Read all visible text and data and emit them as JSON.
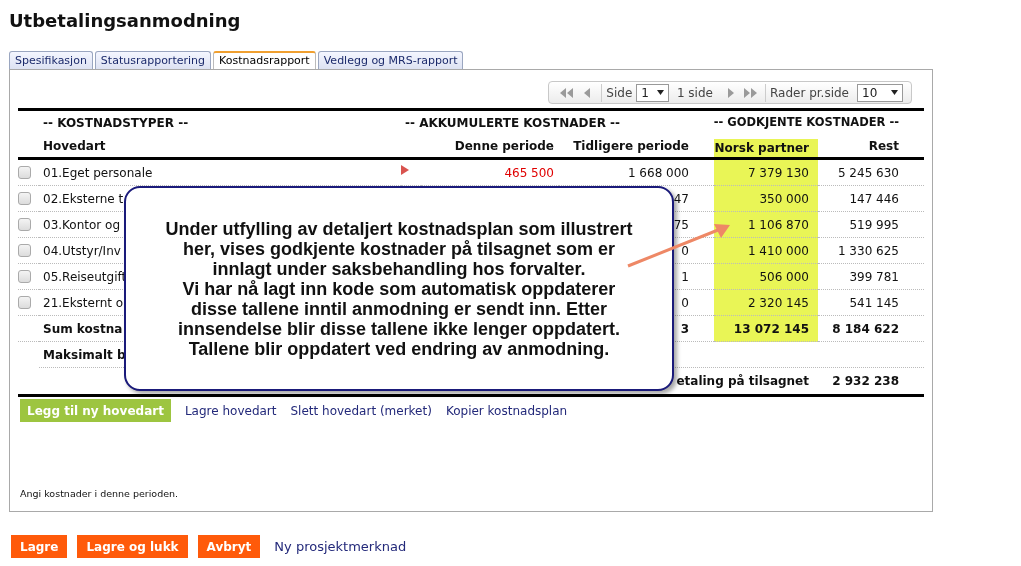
{
  "page_title": "Utbetalingsanmodning",
  "tabs": [
    {
      "label": "Spesifikasjon",
      "selected": false
    },
    {
      "label": "Statusrapportering",
      "selected": false
    },
    {
      "label": "Kostnadsrapport",
      "selected": true
    },
    {
      "label": "Vedlegg og MRS-rapport",
      "selected": false
    }
  ],
  "pager": {
    "page_label": "Side",
    "page": "1",
    "page_count": "1 side",
    "rows_label": "Rader pr.side",
    "rows_per_page": "10"
  },
  "table": {
    "groups": [
      "-- KOSTNADSTYPER --",
      "-- AKKUMULERTE KOSTNADER --",
      "-- GODKJENTE KOSTNADER --"
    ],
    "columns": [
      "Hovedart",
      "Denne periode",
      "Tidligere periode",
      "Norsk partner",
      "Rest"
    ],
    "rows": [
      {
        "kind": "item",
        "checked": false,
        "marker": true,
        "hovedart": "01.Eget personale",
        "denne_periode": "465 500",
        "tidligere_periode": "1 668 000",
        "norsk_partner": "7 379 130",
        "rest": "5 245 630"
      },
      {
        "kind": "item",
        "checked": false,
        "marker": false,
        "hovedart": "02.Eksterne t",
        "tidligere_periode": "47",
        "norsk_partner": "350 000",
        "rest": "147 446"
      },
      {
        "kind": "item",
        "checked": false,
        "marker": false,
        "hovedart": "03.Kontor og",
        "tidligere_periode": "75",
        "norsk_partner": "1 106 870",
        "rest": "519 995"
      },
      {
        "kind": "item",
        "checked": false,
        "marker": false,
        "hovedart": "04.Utstyr/Inv",
        "tidligere_periode": "0",
        "norsk_partner": "1 410 000",
        "rest": "1 330 625"
      },
      {
        "kind": "item",
        "checked": false,
        "marker": false,
        "hovedart": "05.Reiseutgift",
        "tidligere_periode": "1",
        "norsk_partner": "506 000",
        "rest": "399 781"
      },
      {
        "kind": "item",
        "checked": false,
        "marker": false,
        "hovedart": "21.Eksternt o",
        "tidligere_periode": "0",
        "norsk_partner": "2 320 145",
        "rest": "541 145"
      },
      {
        "kind": "sum",
        "hovedart": "Sum kostna",
        "tidligere_periode": "3",
        "norsk_partner": "13 072 145",
        "rest": "8 184 622"
      },
      {
        "kind": "label",
        "hovedart": "Maksimalt b"
      },
      {
        "kind": "total",
        "label": "etaling på tilsagnet",
        "rest": "2 932 238"
      }
    ]
  },
  "actions": {
    "add_button": "Legg til ny hovedart",
    "links": [
      "Lagre hovedart",
      "Slett hovedart (merket)",
      "Kopier kostnadsplan"
    ]
  },
  "note": "Angi kostnader i denne perioden.",
  "footer": {
    "buttons": [
      "Lagre",
      "Lagre og lukk",
      "Avbryt"
    ],
    "link": "Ny prosjektmerknad"
  },
  "callout": {
    "text": "Under utfylling av detaljert kostnadsplan som illustrert\nher, vises godkjente kostnader på tilsagnet som er\ninnlagt under saksbehandling hos forvalter.\nVi har nå lagt inn kode som automatisk oppdaterer\ndisse tallene inntil anmodning er sendt inn. Etter\ninnsendelse blir disse tallene ikke lenger oppdatert.\nTallene blir oppdatert ved endring av anmodning."
  }
}
